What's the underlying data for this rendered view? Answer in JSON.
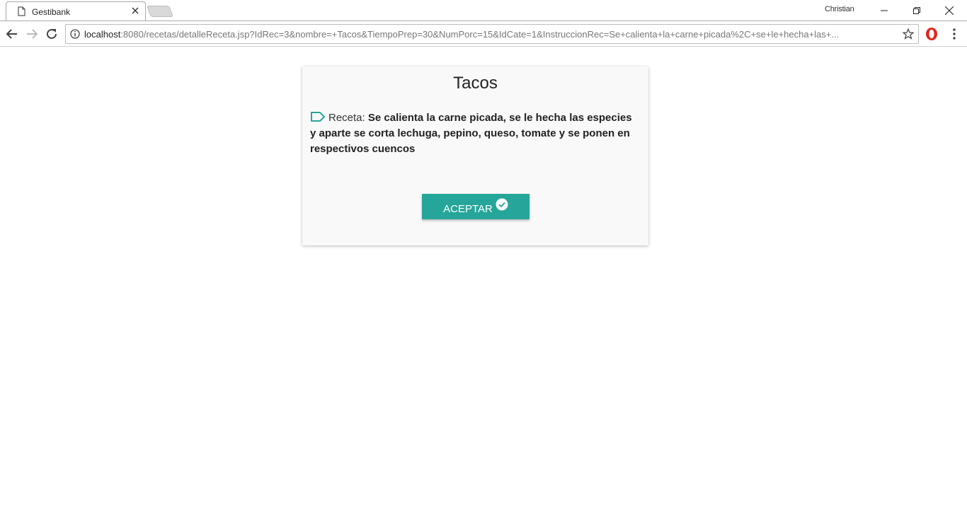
{
  "browser": {
    "tab_title": "Gestibank",
    "user_name": "Christian",
    "url_host": "localhost",
    "url_rest": ":8080/recetas/detalleReceta.jsp?IdRec=3&nombre=+Tacos&TiempoPrep=30&NumPorc=15&IdCate=1&InstruccionRec=Se+calienta+la+carne+picada%2C+se+le+hecha+las+..."
  },
  "recipe": {
    "title": "Tacos",
    "label": "Receta:",
    "instructions": "Se calienta la carne picada, se le hecha las especies y aparte se corta lechuga, pepino, queso, tomate y se ponen en respectivos cuencos"
  },
  "actions": {
    "accept_label": "ACEPTAR"
  },
  "colors": {
    "accent": "#26a69a",
    "card_background": "#f9f9f9"
  },
  "icons": {
    "tab": "page-icon",
    "close": "close-icon",
    "back": "back-arrow-icon",
    "forward": "forward-arrow-icon",
    "reload": "reload-icon",
    "info": "info-icon",
    "star": "star-icon",
    "opera": "opera-icon",
    "menu": "kebab-menu-icon",
    "label": "label-outline-icon",
    "check": "check-circle-icon"
  }
}
